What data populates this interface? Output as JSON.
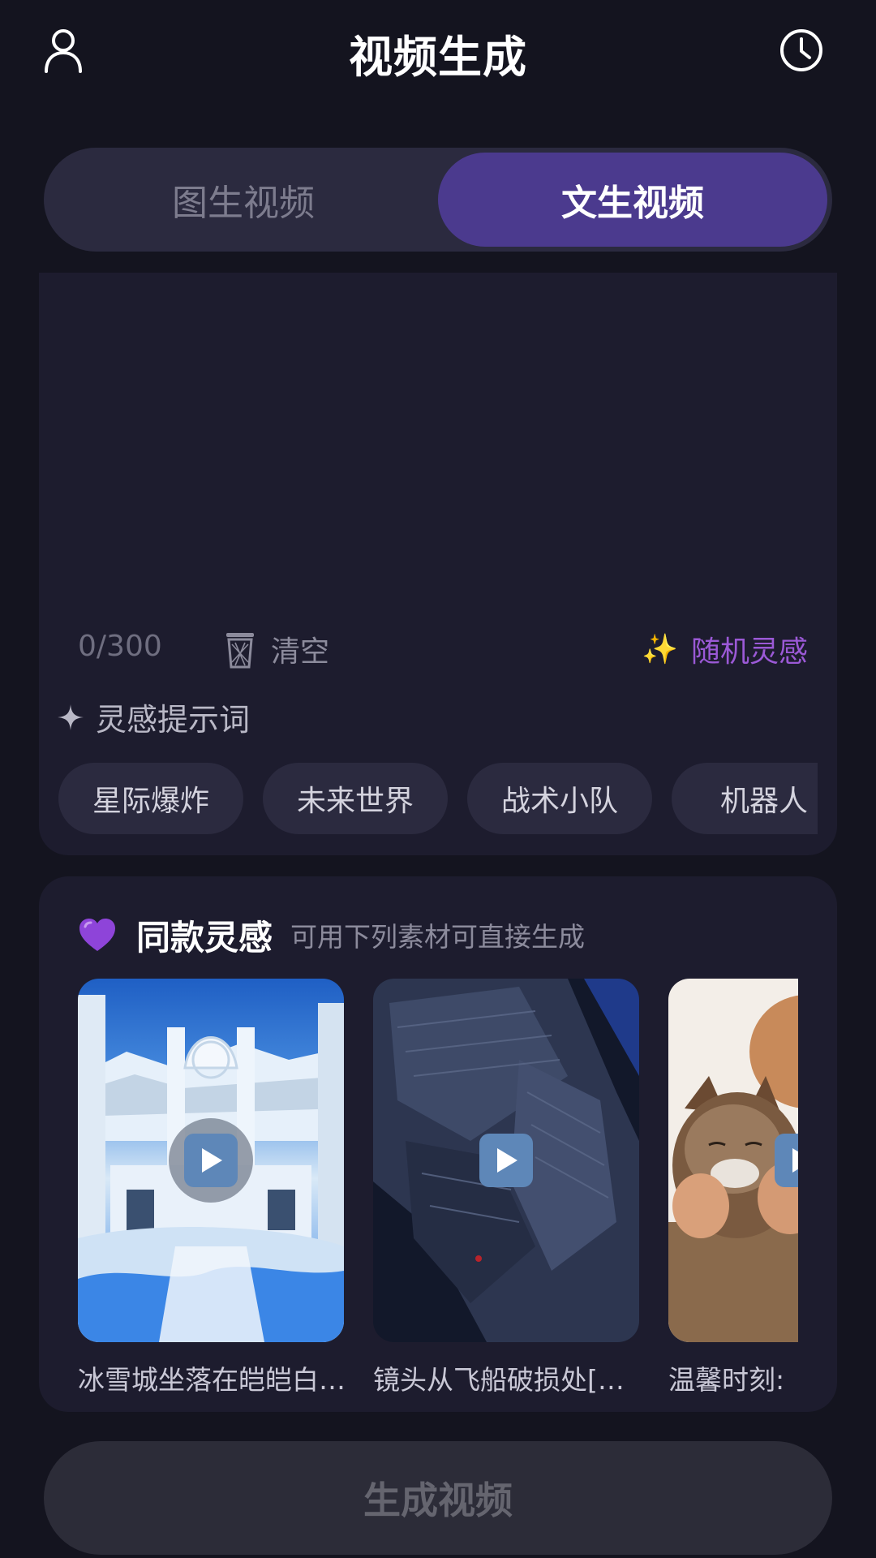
{
  "header": {
    "title": "视频生成",
    "left_icon": "user-icon",
    "right_icon": "clock-history-icon"
  },
  "tabs": [
    {
      "label": "图生视频",
      "active": false
    },
    {
      "label": "文生视频",
      "active": true
    }
  ],
  "prompt_input": {
    "value": "",
    "counter": "0/300",
    "clear_label": "清空",
    "random_label": "随机灵感"
  },
  "hints": {
    "title": "灵感提示词",
    "chips": [
      "星际爆炸",
      "未来世界",
      "战术小队",
      "机器人"
    ]
  },
  "inspiration": {
    "title": "同款灵感",
    "subtitle": "可用下列素材可直接生成",
    "items": [
      {
        "caption": "冰雪城坐落在皑皑白…",
        "icon": "play-icon"
      },
      {
        "caption": "镜头从飞船破损处[…",
        "icon": "play-icon"
      },
      {
        "caption": "温馨时刻:",
        "icon": "play-icon"
      }
    ]
  },
  "generate_button": {
    "label": "生成视频",
    "enabled": false
  },
  "colors": {
    "background": "#14141f",
    "card": "#1d1c2e",
    "accent": "#4b3a8e",
    "random_text": "#9b59d6"
  }
}
